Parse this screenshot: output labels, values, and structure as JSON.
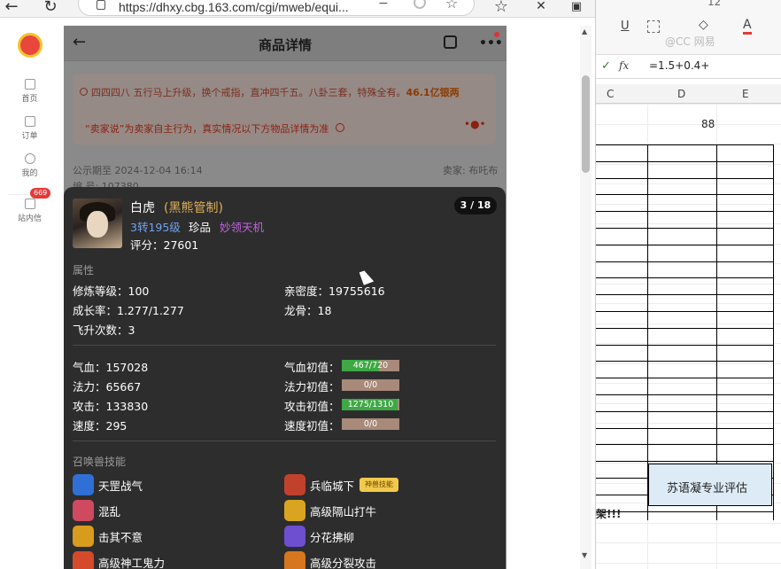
{
  "browser": {
    "url": "https://dhxy.cbg.163.com/cgi/mweb/equi...",
    "back_icon": "←",
    "reload_icon": "↻",
    "zoom_out_icon": "−",
    "star_icon": "☆",
    "favorites_icon": "☆",
    "more_icon": "…"
  },
  "sidebar": {
    "items": [
      {
        "label": "首页"
      },
      {
        "label": "订单"
      },
      {
        "label": "我的"
      },
      {
        "label": "站内信",
        "badge": "669"
      }
    ]
  },
  "page": {
    "title": "商品详情",
    "notice_line1_prefix": "四四四八 五行马上升级，换个戒指，直冲四千五。八卦三套，特殊全有。",
    "notice_line1_price": "46.1亿银两",
    "notice_line2": "“卖家说”为卖家自主行为，真实情况以下方物品详情为准",
    "public_period": "公示期至 2024-12-04 16:14",
    "seller": "卖家: 布吒布",
    "serial": "编 号: 107380"
  },
  "card": {
    "name": "白虎",
    "tag": "(黑熊管制)",
    "level": "3转195级",
    "quality": "珍品",
    "skill_tag": "妙领天机",
    "score": "评分：27601",
    "pager": "3 / 18",
    "section_attrs": "属性",
    "attrs_left": [
      "修炼等级：100",
      "成长率：1.277/1.277",
      "飞升次数：3"
    ],
    "attrs_right": [
      "亲密度：19755616",
      "龙骨：18"
    ],
    "stats": [
      {
        "label": "气血：157028",
        "init_label": "气血初值：",
        "init": "467/720",
        "fill": 0.65,
        "color": "#3ea845"
      },
      {
        "label": "法力：65667",
        "init_label": "法力初值：",
        "init": "0/0",
        "fill": 0,
        "color": "#a8897a"
      },
      {
        "label": "攻击：133830",
        "init_label": "攻击初值：",
        "init": "1275/1310",
        "fill": 0.97,
        "color": "#3ea845"
      },
      {
        "label": "速度：295",
        "init_label": "速度初值：",
        "init": "0/0",
        "fill": 0,
        "color": "#a8897a"
      }
    ],
    "section_skills": "召唤兽技能",
    "skills_left": [
      "天罡战气",
      "混乱",
      "击其不意",
      "高级神工鬼力"
    ],
    "skills_right": [
      "兵临城下",
      "高级隔山打牛",
      "分花拂柳",
      "高级分裂攻击"
    ],
    "skill_badge": "神兽技能",
    "skill_colors_left": [
      "#2f6fd6",
      "#d04a5f",
      "#d99b1e",
      "#d44a2a"
    ],
    "skill_colors_right": [
      "#c2412d",
      "#d9a520",
      "#6d4fd0",
      "#d6761f"
    ]
  },
  "sheet": {
    "formula": "=1.5+0.4+",
    "fx": "fx",
    "check": "✓",
    "font_size": "12",
    "columns": [
      "C",
      "D",
      "E"
    ],
    "cell_d": "88",
    "note": "苏语凝专业评估",
    "row_text": "架!!!",
    "watermark": "@CC 网易"
  }
}
